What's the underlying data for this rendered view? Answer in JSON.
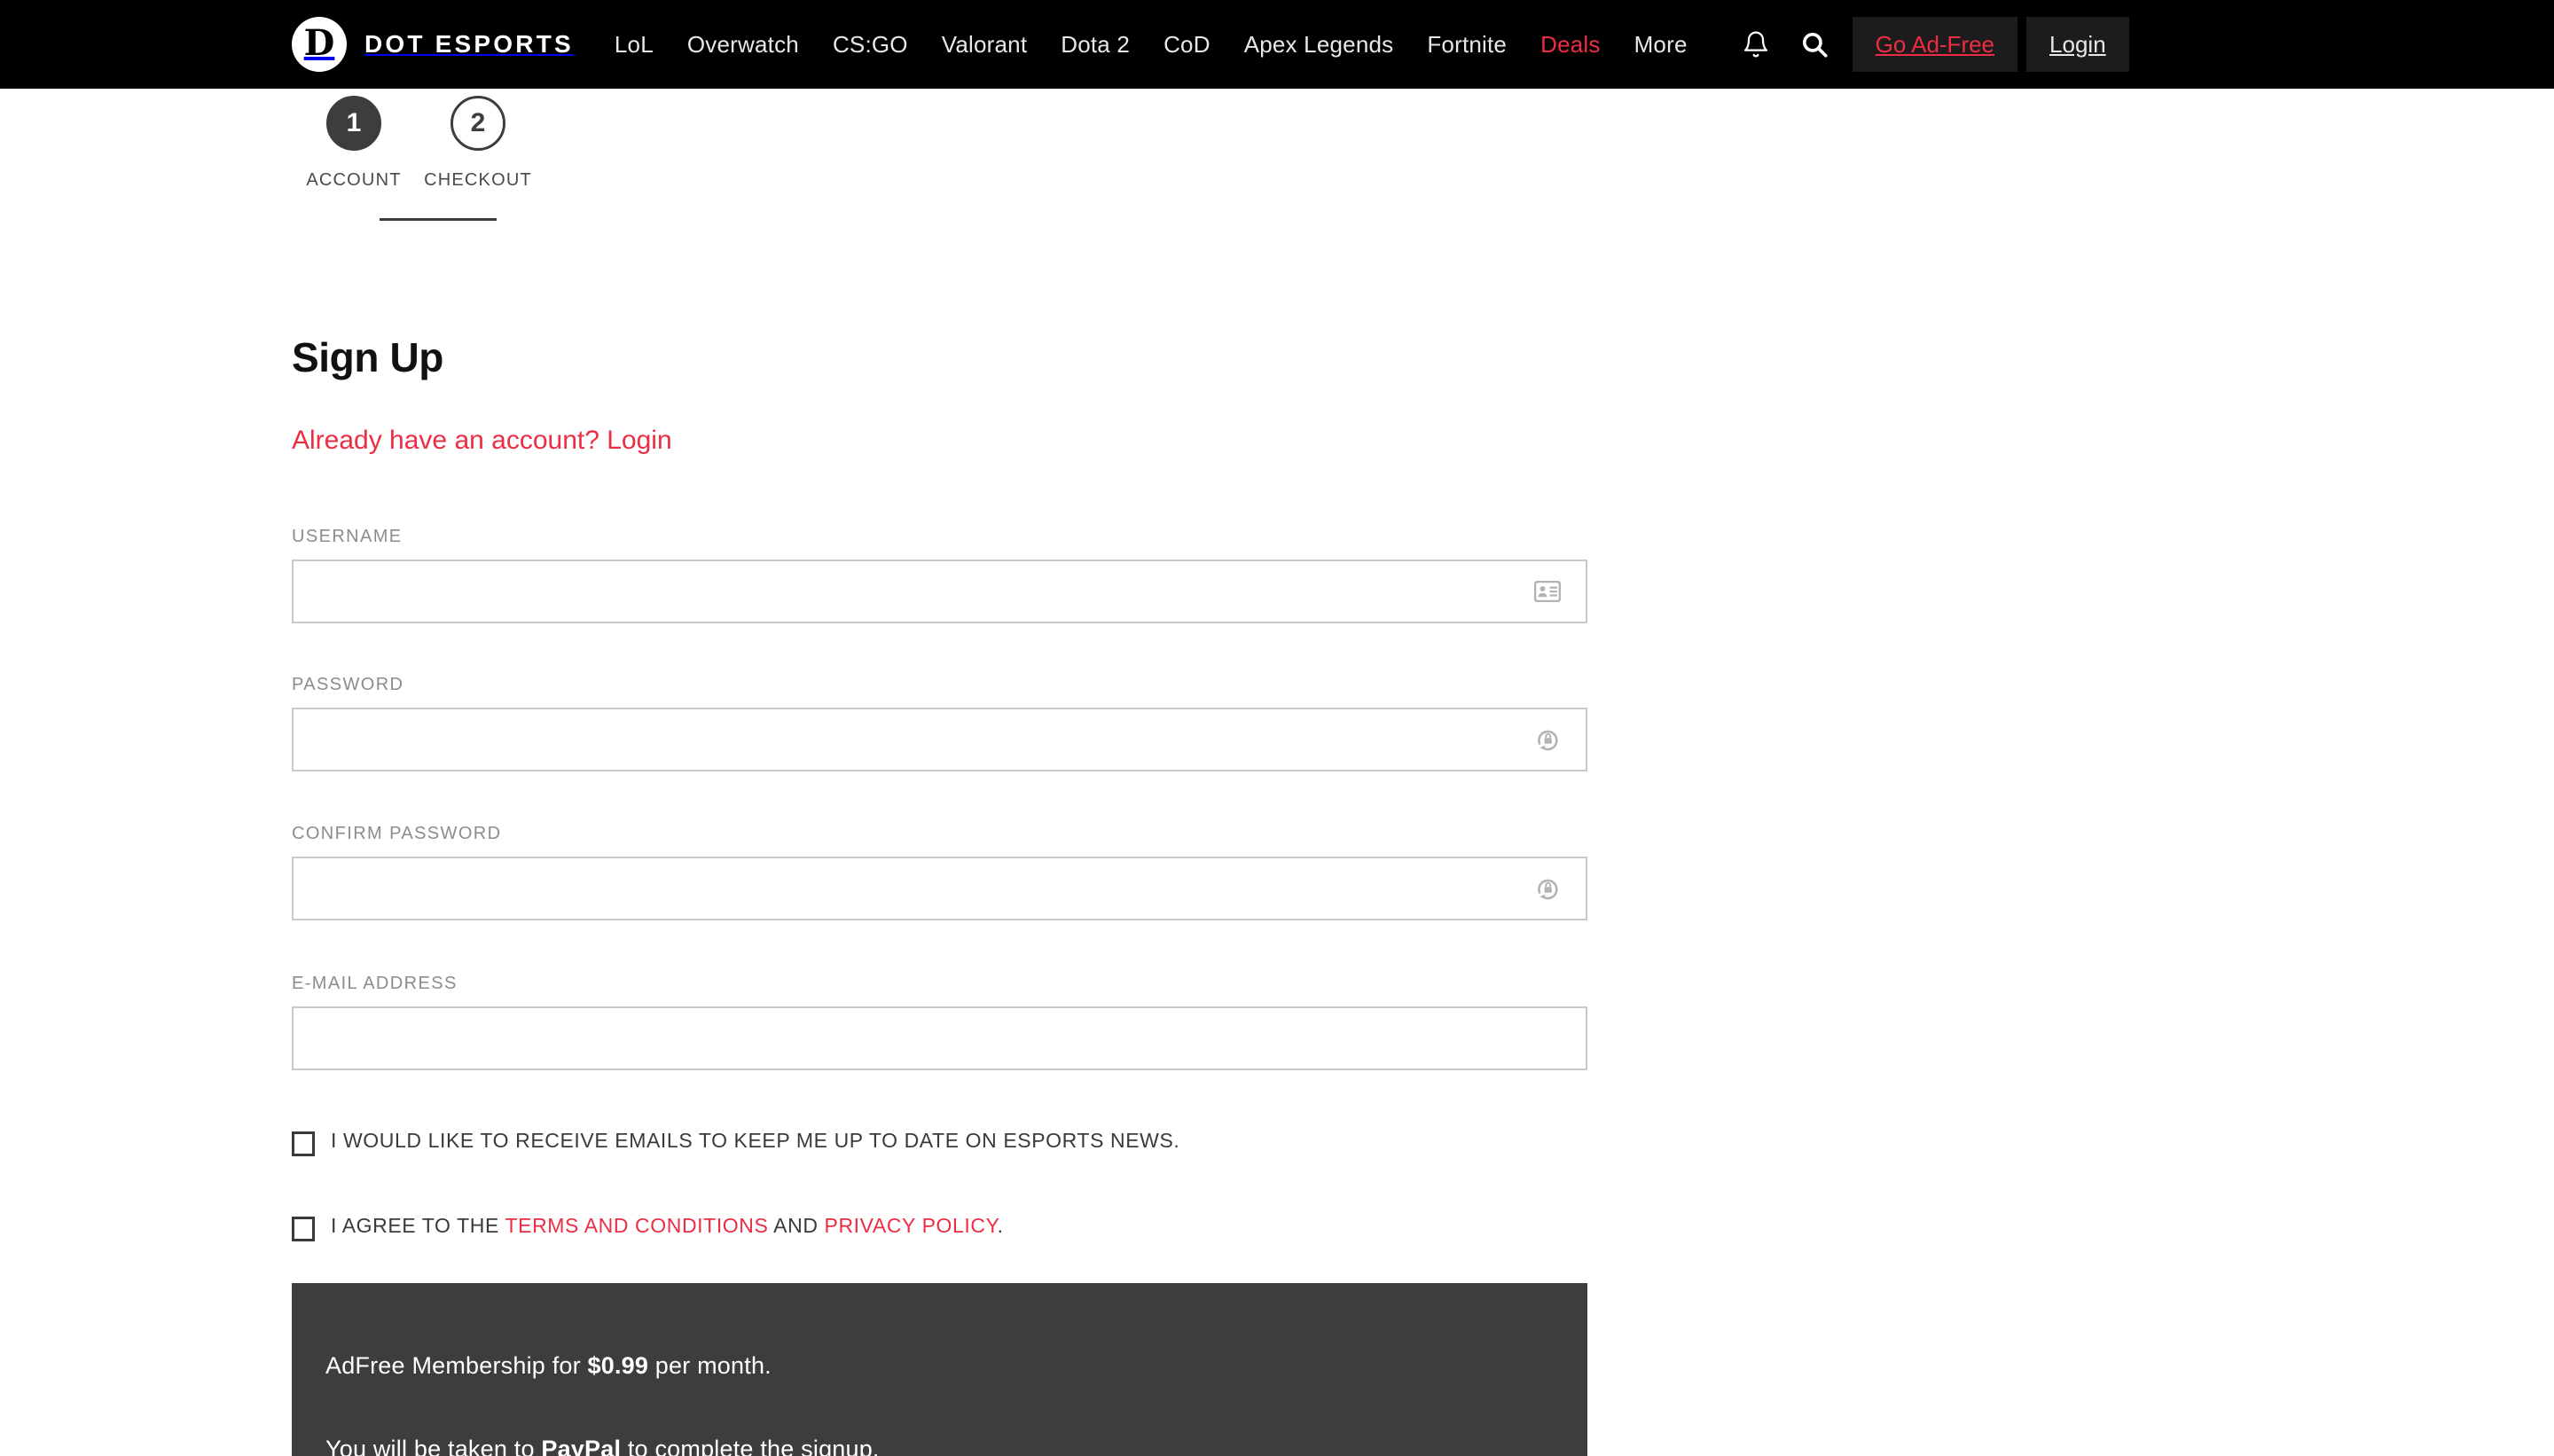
{
  "header": {
    "brand_name": "DOT ESPORTS",
    "logo_glyph": "D",
    "nav": [
      {
        "label": "LoL",
        "accent": false
      },
      {
        "label": "Overwatch",
        "accent": false
      },
      {
        "label": "CS:GO",
        "accent": false
      },
      {
        "label": "Valorant",
        "accent": false
      },
      {
        "label": "Dota 2",
        "accent": false
      },
      {
        "label": "CoD",
        "accent": false
      },
      {
        "label": "Apex Legends",
        "accent": false
      },
      {
        "label": "Fortnite",
        "accent": false
      },
      {
        "label": "Deals",
        "accent": true
      },
      {
        "label": "More",
        "accent": false
      }
    ],
    "notifications_icon": "bell-icon",
    "search_icon": "search-icon",
    "go_ad_free_label": "Go Ad-Free",
    "login_label": "Login",
    "accent_color": "#ec2d43",
    "background_color": "#000000"
  },
  "stepper": {
    "steps": [
      {
        "number": "1",
        "label": "ACCOUNT",
        "state": "active"
      },
      {
        "number": "2",
        "label": "CHECKOUT",
        "state": "inactive"
      }
    ]
  },
  "form": {
    "title": "Sign Up",
    "login_prompt": "Already have an account? Login",
    "fields": [
      {
        "label": "USERNAME",
        "value": "",
        "placeholder": "",
        "icon": "id-card-icon",
        "type": "text"
      },
      {
        "label": "PASSWORD",
        "value": "",
        "placeholder": "",
        "icon": "lock-refresh-icon",
        "type": "password"
      },
      {
        "label": "CONFIRM PASSWORD",
        "value": "",
        "placeholder": "",
        "icon": "lock-refresh-icon",
        "type": "password"
      },
      {
        "label": "E-MAIL ADDRESS",
        "value": "",
        "placeholder": "",
        "icon": "",
        "type": "email"
      }
    ],
    "checkboxes": [
      {
        "checked": false,
        "text_before": "I WOULD LIKE TO RECEIVE EMAILS TO KEEP ME UP TO DATE ON ESPORTS NEWS.",
        "link1": "",
        "text_middle": "",
        "link2": "",
        "text_after": ""
      },
      {
        "checked": false,
        "text_before": "I AGREE TO THE ",
        "link1": "TERMS AND CONDITIONS",
        "text_middle": " AND ",
        "link2": "PRIVACY POLICY",
        "text_after": "."
      }
    ]
  },
  "ad_panel": {
    "line1_prefix": "AdFree Membership for ",
    "line1_price": "$0.99",
    "line1_suffix": " per month.",
    "line2_prefix": "You will be taken to ",
    "line2_brand": "PayPal",
    "line2_suffix": " to complete the signup.",
    "background_color": "#3d3d3d"
  }
}
